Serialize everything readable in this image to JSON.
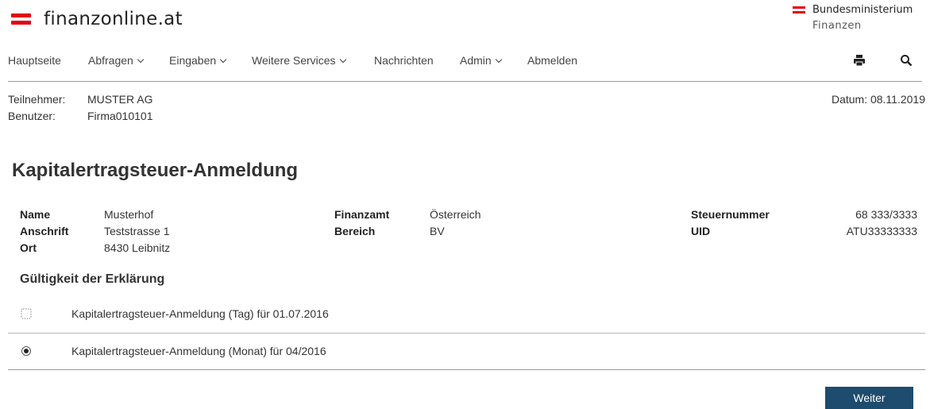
{
  "header": {
    "logo_text": "finanzonline.at",
    "ministry_line1": "Bundesministerium",
    "ministry_line2": "Finanzen"
  },
  "nav": {
    "items": [
      {
        "label": "Hauptseite",
        "dropdown": false
      },
      {
        "label": "Abfragen",
        "dropdown": true
      },
      {
        "label": "Eingaben",
        "dropdown": true
      },
      {
        "label": "Weitere Services",
        "dropdown": true
      },
      {
        "label": "Nachrichten",
        "dropdown": false
      },
      {
        "label": "Admin",
        "dropdown": true
      },
      {
        "label": "Abmelden",
        "dropdown": false
      }
    ],
    "icons": [
      "print-icon",
      "search-icon"
    ]
  },
  "user_info": {
    "participant_label": "Teilnehmer:",
    "participant_value": "MUSTER AG",
    "user_label": "Benutzer:",
    "user_value": "Firma010101",
    "date": "Datum: 08.11.2019"
  },
  "page_title": "Kapitalertragsteuer-Anmeldung",
  "details": {
    "name_label": "Name",
    "name_value": "Musterhof",
    "address_label": "Anschrift",
    "address_value": "Teststrasse 1",
    "city_label": "Ort",
    "city_value": "8430 Leibnitz",
    "tax_office_label": "Finanzamt",
    "tax_office_value": "Österreich",
    "area_label": "Bereich",
    "area_value": "BV",
    "tax_number_label": "Steuernummer",
    "tax_number_value": "68 333/3333",
    "uid_label": "UID",
    "uid_value": "ATU33333333"
  },
  "validity": {
    "heading": "Gültigkeit der Erklärung",
    "options": [
      {
        "label": "Kapitalertragsteuer-Anmeldung (Tag) für 01.07.2016",
        "selected": false
      },
      {
        "label": "Kapitalertragsteuer-Anmeldung (Monat) für 04/2016",
        "selected": true
      }
    ]
  },
  "actions": {
    "next_label": "Weiter"
  },
  "colors": {
    "brand_red": "#e3000f",
    "button_blue": "#1e4c6e"
  }
}
